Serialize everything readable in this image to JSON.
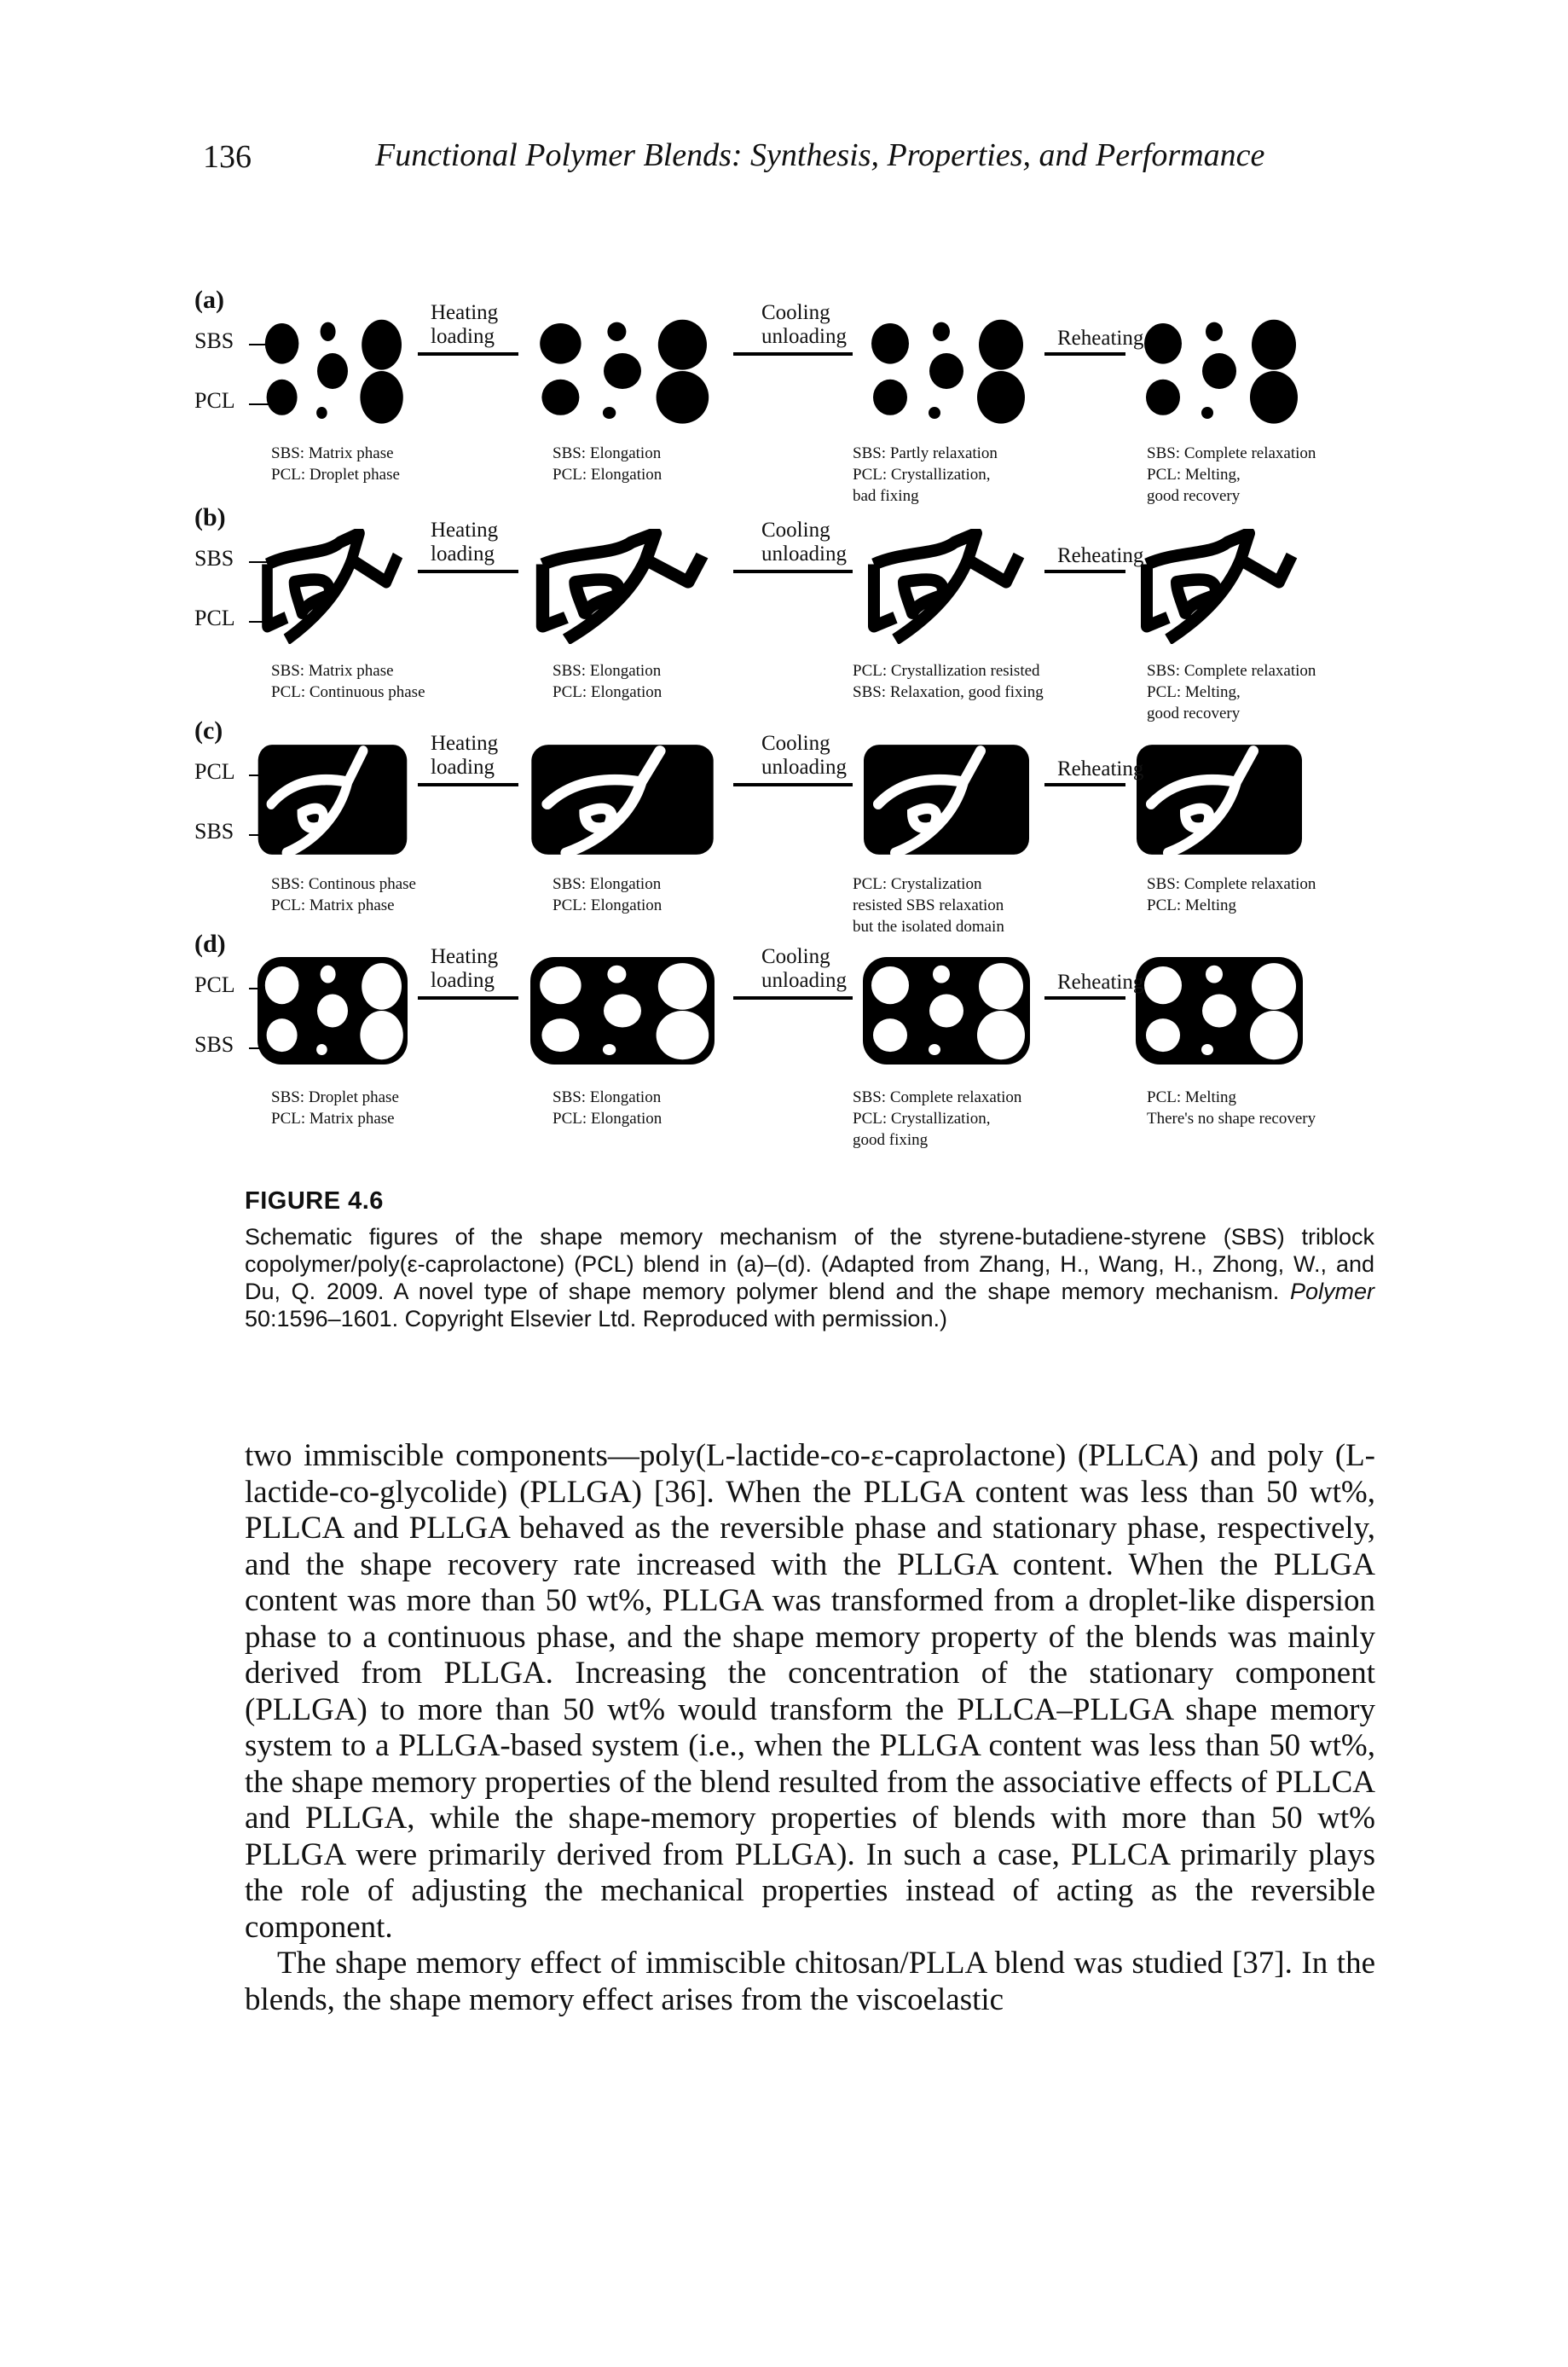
{
  "header": {
    "page_number": "136",
    "running_head": "Functional Polymer Blends: Synthesis, Properties, and Performance"
  },
  "figure": {
    "panels": [
      {
        "letter": "(a)",
        "side_labels": [
          "SBS",
          "PCL"
        ],
        "steps": [
          "Heating\nloading",
          "Cooling\nunloading",
          "Reheating"
        ],
        "captions": [
          [
            "SBS: Matrix phase",
            "PCL: Droplet phase"
          ],
          [
            "SBS: Elongation",
            "PCL: Elongation"
          ],
          [
            "SBS: Partly relaxation",
            "PCL: Crystallization,",
            "bad fixing"
          ],
          [
            "SBS: Complete relaxation",
            "PCL: Melting,",
            "good recovery"
          ]
        ]
      },
      {
        "letter": "(b)",
        "side_labels": [
          "SBS",
          "PCL"
        ],
        "steps": [
          "Heating\nloading",
          "Cooling\nunloading",
          "Reheating"
        ],
        "captions": [
          [
            "SBS: Matrix phase",
            "PCL: Continuous phase"
          ],
          [
            "SBS: Elongation",
            "PCL: Elongation"
          ],
          [
            "PCL: Crystallization resisted",
            "SBS: Relaxation, good fixing"
          ],
          [
            "SBS: Complete relaxation",
            "PCL: Melting,",
            "good recovery"
          ]
        ]
      },
      {
        "letter": "(c)",
        "side_labels": [
          "PCL",
          "SBS"
        ],
        "steps": [
          "Heating\nloading",
          "Cooling\nunloading",
          "Reheating"
        ],
        "captions": [
          [
            "SBS: Continous phase",
            "PCL: Matrix phase"
          ],
          [
            "SBS: Elongation",
            "PCL: Elongation"
          ],
          [
            "PCL: Crystalization",
            "resisted SBS relaxation",
            "but the isolated domain"
          ],
          [
            "SBS: Complete relaxation",
            "PCL: Melting"
          ]
        ]
      },
      {
        "letter": "(d)",
        "side_labels": [
          "PCL",
          "SBS"
        ],
        "steps": [
          "Heating\nloading",
          "Cooling\nunloading",
          "Reheating"
        ],
        "captions": [
          [
            "SBS: Droplet phase",
            "PCL: Matrix phase"
          ],
          [
            "SBS: Elongation",
            "PCL: Elongation"
          ],
          [
            "SBS: Complete relaxation",
            "PCL: Crystallization,",
            "good fixing"
          ],
          [
            "PCL: Melting",
            "There's no shape recovery"
          ]
        ]
      }
    ],
    "label": "FIGURE 4.6",
    "caption_before_italic": "Schematic figures of the shape memory mechanism of the styrene-butadiene-styrene (SBS) triblock copolymer/poly(ε-caprolactone) (PCL) blend in (a)–(d). (Adapted from Zhang, H., Wang, H., Zhong, W., and Du, Q. 2009. A novel type of shape memory polymer blend and the shape memory mechanism. ",
    "caption_italic": "Polymer",
    "caption_after_italic": " 50:1596–1601. Copyright Elsevier Ltd. Reproduced with permission.)"
  },
  "body": {
    "paragraph_1": "two immiscible components—poly(L-lactide-co-ε-caprolactone) (PLLCA) and poly (L-lactide-co-glycolide) (PLLGA) [36]. When the PLLGA content was less than 50 wt%, PLLCA and PLLGA behaved as the reversible phase and stationary phase, respectively, and the shape recovery rate increased with the PLLGA content. When the PLLGA content was more than 50 wt%, PLLGA was transformed from a droplet-like dispersion phase to a continuous phase, and the shape memory property of the blends was mainly derived from PLLGA. Increasing the concentration of the stationary component (PLLGA) to more than 50 wt% would transform the PLLCA–PLLGA shape memory system to a PLLGA-based system (i.e., when the PLLGA content was less than 50 wt%, the shape memory properties of the blend resulted from the associative effects of PLLCA and PLLGA, while the shape-memory properties of blends with more than 50 wt% PLLGA were primarily derived from PLLGA). In such a case, PLLCA primarily plays the role of adjusting the mechanical properties instead of acting as the reversible component.",
    "paragraph_2": "The shape memory effect of immiscible chitosan/PLLA blend was studied [37]. In the blends, the shape memory effect arises from the viscoelastic"
  }
}
